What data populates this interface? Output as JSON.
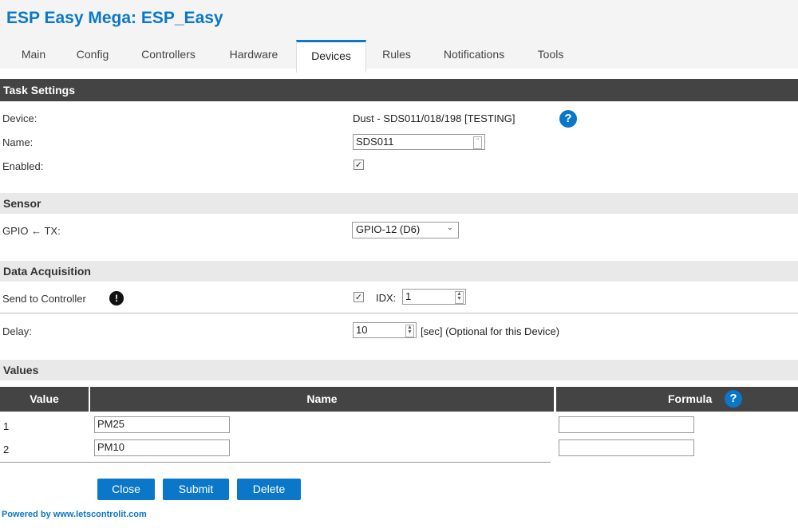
{
  "app": {
    "title": "ESP Easy Mega: ESP_Easy"
  },
  "tabs": [
    {
      "label": "Main"
    },
    {
      "label": "Config"
    },
    {
      "label": "Controllers"
    },
    {
      "label": "Hardware"
    },
    {
      "label": "Devices"
    },
    {
      "label": "Rules"
    },
    {
      "label": "Notifications"
    },
    {
      "label": "Tools"
    }
  ],
  "active_tab": "Devices",
  "task_settings": {
    "heading": "Task Settings",
    "device_label": "Device:",
    "device_value": "Dust - SDS011/018/198 [TESTING]",
    "name_label": "Name:",
    "name_value": "SDS011",
    "enabled_label": "Enabled:",
    "enabled_checked": true
  },
  "sensor": {
    "heading": "Sensor",
    "gpio_label": "GPIO ← TX:",
    "gpio_value": "GPIO-12 (D6)"
  },
  "data_acquisition": {
    "heading": "Data Acquisition",
    "send_label": "Send to Controller",
    "send_checked": true,
    "idx_label": "IDX:",
    "idx_value": "1",
    "delay_label": "Delay:",
    "delay_value": "10",
    "delay_suffix": "[sec] (Optional for this Device)"
  },
  "values": {
    "heading": "Values",
    "columns": [
      "Value",
      "Name",
      "Formula"
    ],
    "rows": [
      {
        "index": "1",
        "name": "PM25",
        "formula": ""
      },
      {
        "index": "2",
        "name": "PM10",
        "formula": ""
      }
    ]
  },
  "buttons": {
    "close": "Close",
    "submit": "Submit",
    "delete": "Delete"
  },
  "footer": {
    "text": "Powered by www.letscontrolit.com"
  },
  "icons": {
    "help": "help-circle-icon",
    "info": "info-circle-icon"
  },
  "colors": {
    "accent": "#0a77c8",
    "section_dark": "#444444",
    "section_light": "#e9e9e9"
  }
}
